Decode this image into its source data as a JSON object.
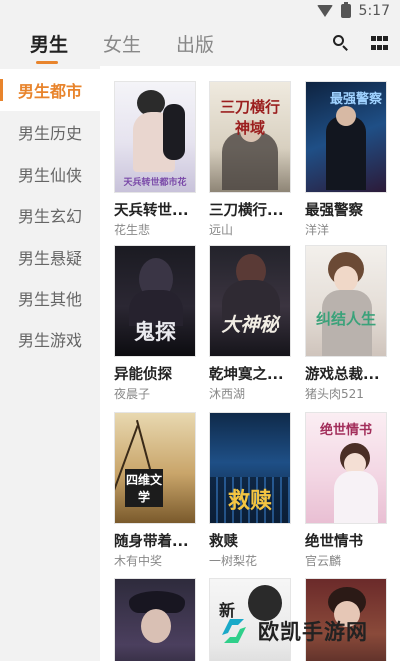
{
  "status_bar": {
    "time": "5:17"
  },
  "tabs": [
    {
      "label": "男生",
      "active": true
    },
    {
      "label": "女生",
      "active": false
    },
    {
      "label": "出版",
      "active": false
    }
  ],
  "colors": {
    "accent": "#e8842c",
    "sidebar_bg": "#f2f2f2"
  },
  "sidebar": {
    "items": [
      {
        "label": "男生都市",
        "active": true
      },
      {
        "label": "男生历史",
        "active": false
      },
      {
        "label": "男生仙侠",
        "active": false
      },
      {
        "label": "男生玄幻",
        "active": false
      },
      {
        "label": "男生悬疑",
        "active": false
      },
      {
        "label": "男生其他",
        "active": false
      },
      {
        "label": "男生游戏",
        "active": false
      }
    ]
  },
  "books": [
    {
      "title": "天兵转世...",
      "author": "花生悲",
      "cover_text": "天兵转世都市花"
    },
    {
      "title": "三刀横行...",
      "author": "远山",
      "cover_text": "三刀横行神域"
    },
    {
      "title": "最强警察",
      "author": "洋洋",
      "cover_text": "最强警察"
    },
    {
      "title": "异能侦探",
      "author": "夜晨子",
      "cover_text": "鬼探"
    },
    {
      "title": "乾坤寞之...",
      "author": "沐西湖",
      "cover_text": "大神秘"
    },
    {
      "title": "游戏总裁...",
      "author": "猪头肉521",
      "cover_text": "纠结人生"
    },
    {
      "title": "随身带着...",
      "author": "木有中奖",
      "cover_text": "四维文学"
    },
    {
      "title": "救赎",
      "author": "一树梨花",
      "cover_text": "救赎"
    },
    {
      "title": "绝世情书",
      "author": "官云麟",
      "cover_text": "绝世情书"
    },
    {
      "title": "",
      "author": "",
      "cover_text": ""
    },
    {
      "title": "",
      "author": "",
      "cover_text": "新"
    },
    {
      "title": "",
      "author": "",
      "cover_text": ""
    }
  ],
  "watermark": {
    "text": "欧凯手游网"
  }
}
